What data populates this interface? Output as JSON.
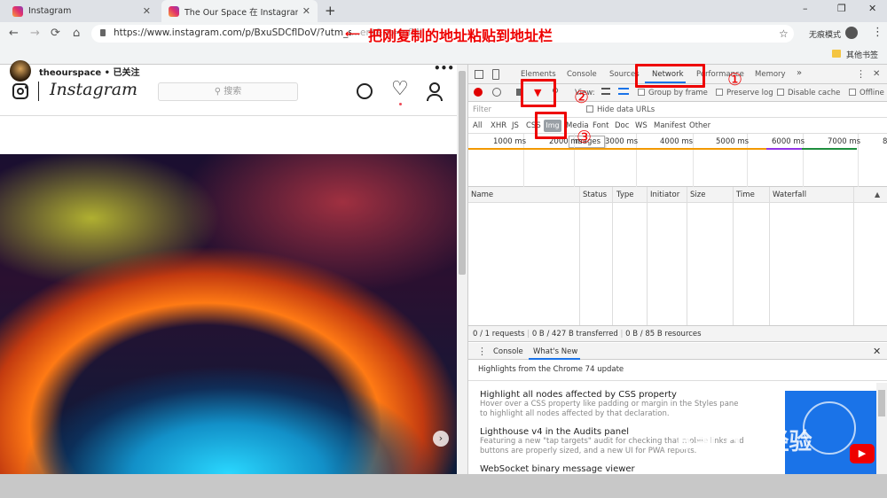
{
  "browser": {
    "tabs": [
      {
        "label": "Instagram"
      },
      {
        "label": "The Our Space 在 Instagram 上"
      }
    ],
    "new_tab": "+",
    "window_controls": {
      "minimize": "–",
      "restore": "❐",
      "close": "✕"
    },
    "nav": {
      "back": "←",
      "forward": "→",
      "reload": "⟳",
      "home": "⌂"
    },
    "url": "https://www.instagram.com/p/BxuSDCflDoV/?utm_so",
    "url_tail": "...ent&ep=nfl4l",
    "incognito_label": "无痕模式",
    "bookmark_folder": "其他书签",
    "star": "☆",
    "menu": "⋮"
  },
  "annotation": {
    "arrow": "⟵",
    "note": "把刚复制的地址粘贴到地址栏",
    "marker1": "①",
    "marker2": "②",
    "marker3": "③"
  },
  "instagram": {
    "wordmark": "Instagram",
    "search_placeholder": "搜索",
    "search_icon": "⚲",
    "compass": "⊘",
    "heart": "♡",
    "profile": "⚇",
    "username": "theourspace",
    "follow_status": "• 已关注",
    "more": "•••",
    "next": "›"
  },
  "devtools": {
    "tabs": [
      "Elements",
      "Console",
      "Sources",
      "Network",
      "Performance",
      "Memory",
      "»"
    ],
    "toolbar": {
      "view": "View:",
      "group_by_frame": "Group by frame",
      "preserve_log": "Preserve log",
      "disable_cache": "Disable cache",
      "offline": "Offline"
    },
    "filter_placeholder": "Filter",
    "hide_data_urls": "Hide data URLs",
    "types": [
      "All",
      "XHR",
      "JS",
      "CSS",
      "Img",
      "Media",
      "Font",
      "Doc",
      "WS",
      "Manifest",
      "Other"
    ],
    "img_tooltip": "Images",
    "ticks": [
      "1000 ms",
      "2000 ms",
      "3000 ms",
      "4000 ms",
      "5000 ms",
      "6000 ms",
      "7000 ms",
      "8"
    ],
    "columns": [
      "Name",
      "Status",
      "Type",
      "Initiator",
      "Size",
      "Time",
      "Waterfall"
    ],
    "status": {
      "requests": "0 / 1 requests",
      "transferred": "0 B / 427 B transferred",
      "resources": "0 B / 85 B resources"
    },
    "drawer_tabs": [
      "Console",
      "What's New"
    ],
    "highlights": "Highlights from the Chrome 74 update",
    "whats_new": [
      {
        "title": "Highlight all nodes affected by CSS property",
        "desc": "Hover over a CSS property like padding or margin in the Styles pane to highlight all nodes affected by that declaration."
      },
      {
        "title": "Lighthouse v4 in the Audits panel",
        "desc": "Featuring a new \"tap targets\" audit for checking that mobile links and buttons are properly sized, and a new UI for PWA reports."
      },
      {
        "title": "WebSocket binary message viewer",
        "desc": ""
      }
    ]
  },
  "watermark": {
    "logo": "Bai du 经验",
    "sub": "jingyan.baidu.com"
  },
  "colors": {
    "accent": "#1a73e8",
    "annotation_red": "#ee0000",
    "record_red": "#e00000"
  }
}
